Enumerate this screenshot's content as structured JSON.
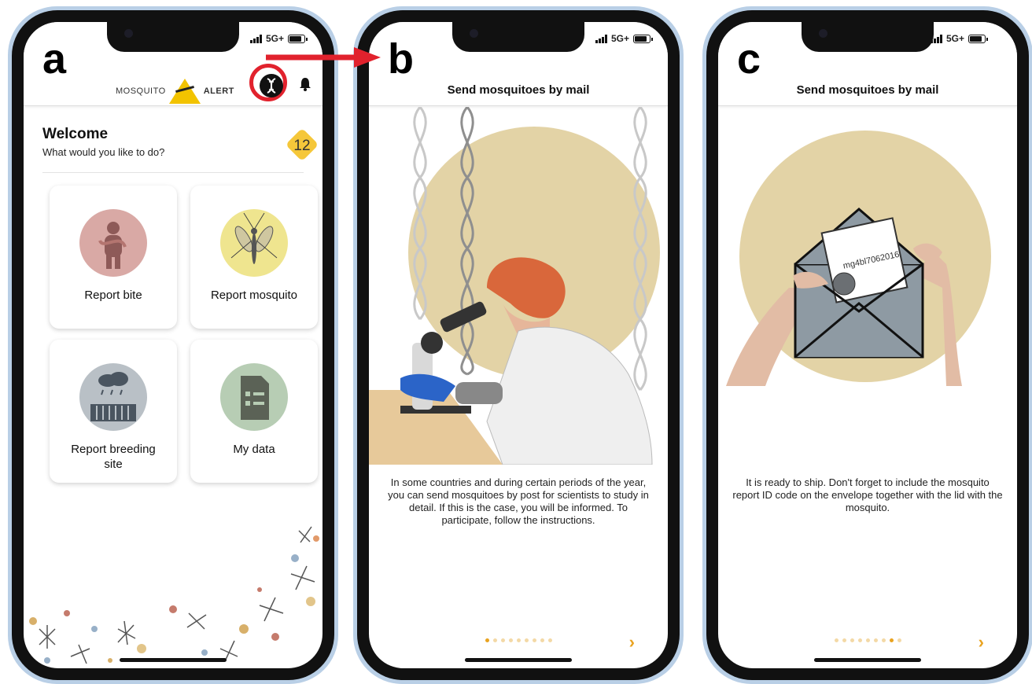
{
  "status_bar": {
    "network": "5G+"
  },
  "panel_a": {
    "letter": "a",
    "logo": {
      "left": "MOSQUITO",
      "right": "ALERT"
    },
    "welcome_title": "Welcome",
    "welcome_subtitle": "What would you like to do?",
    "score_badge": "12",
    "cards": [
      {
        "label": "Report bite",
        "icon": "bite-icon"
      },
      {
        "label": "Report mosquito",
        "icon": "mosquito-icon"
      },
      {
        "label": "Report breeding site",
        "icon": "breeding-site-icon"
      },
      {
        "label": "My data",
        "icon": "document-icon"
      }
    ]
  },
  "panel_b": {
    "letter": "b",
    "title": "Send mosquitoes by mail",
    "description": "In some countries and during certain periods of the year, you can send mosquitoes by post for scientists to study in detail. If this is the case, you will be informed. To participate, follow the instructions.",
    "page_dots": 9,
    "active_dot": 1
  },
  "panel_c": {
    "letter": "c",
    "title": "Send mosquitoes by mail",
    "envelope_code": "mg4bl7062016",
    "description": "It is ready to ship. Don't forget to include the mosquito report ID code on the envelope together with the lid with the mosquito.",
    "page_dots": 9,
    "active_dot": 8
  },
  "colors": {
    "accent": "#e9a320",
    "highlight_ring": "#e1222d",
    "badge": "#f5c73a",
    "illustration_circle": "#e3d3a6"
  }
}
